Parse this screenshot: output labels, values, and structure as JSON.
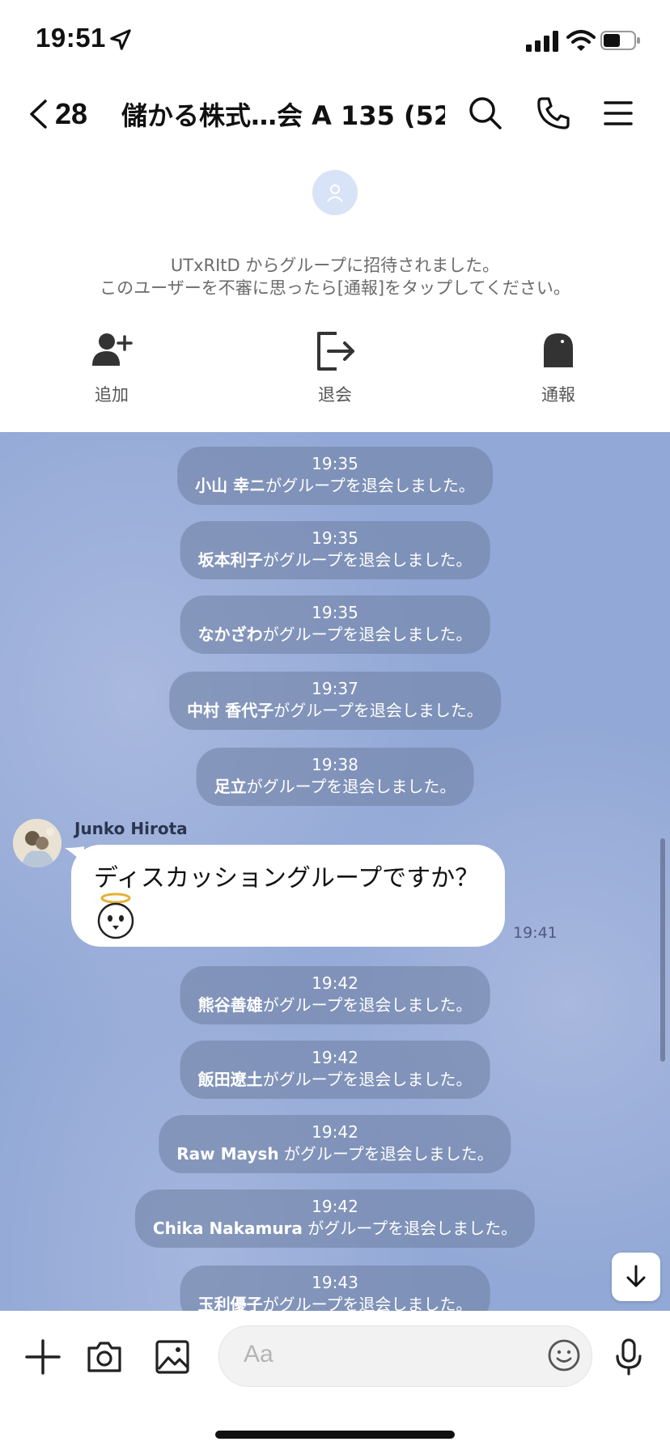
{
  "status_bar": {
    "time": "19:51"
  },
  "header": {
    "back_count": "28",
    "title": "儲かる株式…会 A 135 (52)",
    "icons": [
      "search-icon",
      "phone-icon",
      "menu-icon"
    ]
  },
  "info": {
    "line1": "UTxRItD からグループに招待されました。",
    "line2": "このユーザーを不審に思ったら[通報]をタップしてください。",
    "actions": [
      {
        "label": "追加",
        "icon": "add-friend-icon"
      },
      {
        "label": "退会",
        "icon": "leave-icon"
      },
      {
        "label": "通報",
        "icon": "report-icon"
      }
    ]
  },
  "system_suffix": "がグループを退会しました。",
  "system_messages": [
    {
      "time": "19:35",
      "name": "小山 幸ニ"
    },
    {
      "time": "19:35",
      "name": "坂本利子"
    },
    {
      "time": "19:35",
      "name": "なかざわ"
    },
    {
      "time": "19:37",
      "name": "中村 香代子"
    },
    {
      "time": "19:38",
      "name": "足立"
    },
    {
      "time": "19:42",
      "name": "熊谷善雄"
    },
    {
      "time": "19:42",
      "name": "飯田遼土"
    },
    {
      "time": "19:42",
      "name": "Raw Maysh"
    },
    {
      "time": "19:42",
      "name": "Chika Nakamura"
    },
    {
      "time": "19:43",
      "name": "玉利優子"
    }
  ],
  "message": {
    "sender": "Junko Hirota",
    "text": "ディスカッショングループですか？",
    "time": "19:41"
  },
  "composer": {
    "placeholder": "Aa"
  },
  "colors": {
    "chat_bg": "#92a8d6",
    "system_bubble": "#6e7da0"
  }
}
